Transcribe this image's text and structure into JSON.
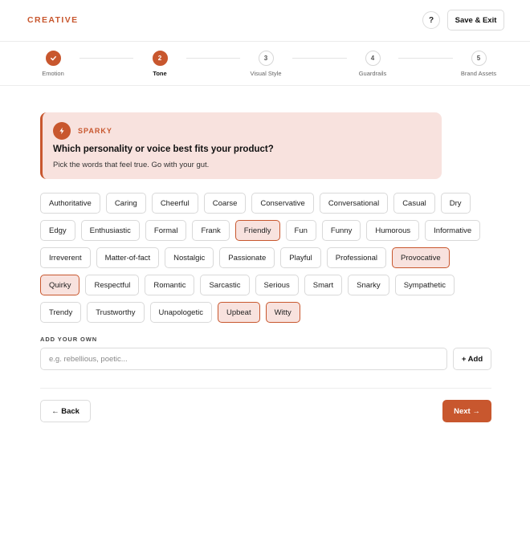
{
  "header": {
    "brand": "CREATIVE",
    "help_label": "?",
    "save_exit_label": "Save & Exit"
  },
  "stepper": {
    "steps": [
      {
        "label": "Emotion",
        "number": "1",
        "state": "done"
      },
      {
        "label": "Tone",
        "number": "2",
        "state": "active"
      },
      {
        "label": "Visual Style",
        "number": "3",
        "state": "pending"
      },
      {
        "label": "Guardrails",
        "number": "4",
        "state": "pending"
      },
      {
        "label": "Brand Assets",
        "number": "5",
        "state": "pending"
      }
    ],
    "done_icon": "checkmark-icon"
  },
  "card": {
    "icon": "lightning-icon",
    "tag": "SPARKY",
    "title": "Which personality or voice best fits your product?",
    "subtitle": "Pick the words that feel true. Go with your gut."
  },
  "chips": [
    {
      "label": "Authoritative",
      "selected": false
    },
    {
      "label": "Caring",
      "selected": false
    },
    {
      "label": "Cheerful",
      "selected": false
    },
    {
      "label": "Coarse",
      "selected": false
    },
    {
      "label": "Conservative",
      "selected": false
    },
    {
      "label": "Conversational",
      "selected": false
    },
    {
      "label": "Casual",
      "selected": false
    },
    {
      "label": "Dry",
      "selected": false
    },
    {
      "label": "Edgy",
      "selected": false
    },
    {
      "label": "Enthusiastic",
      "selected": false
    },
    {
      "label": "Formal",
      "selected": false
    },
    {
      "label": "Frank",
      "selected": false
    },
    {
      "label": "Friendly",
      "selected": true
    },
    {
      "label": "Fun",
      "selected": false
    },
    {
      "label": "Funny",
      "selected": false
    },
    {
      "label": "Humorous",
      "selected": false
    },
    {
      "label": "Informative",
      "selected": false
    },
    {
      "label": "Irreverent",
      "selected": false
    },
    {
      "label": "Matter-of-fact",
      "selected": false
    },
    {
      "label": "Nostalgic",
      "selected": false
    },
    {
      "label": "Passionate",
      "selected": false
    },
    {
      "label": "Playful",
      "selected": false
    },
    {
      "label": "Professional",
      "selected": false
    },
    {
      "label": "Provocative",
      "selected": true
    },
    {
      "label": "Quirky",
      "selected": true
    },
    {
      "label": "Respectful",
      "selected": false
    },
    {
      "label": "Romantic",
      "selected": false
    },
    {
      "label": "Sarcastic",
      "selected": false
    },
    {
      "label": "Serious",
      "selected": false
    },
    {
      "label": "Smart",
      "selected": false
    },
    {
      "label": "Snarky",
      "selected": false
    },
    {
      "label": "Sympathetic",
      "selected": false
    },
    {
      "label": "Trendy",
      "selected": false
    },
    {
      "label": "Trustworthy",
      "selected": false
    },
    {
      "label": "Unapologetic",
      "selected": false
    },
    {
      "label": "Upbeat",
      "selected": true
    },
    {
      "label": "Witty",
      "selected": true
    }
  ],
  "add_own": {
    "label": "ADD YOUR OWN",
    "placeholder": "e.g. rebellious, poetic...",
    "value": "",
    "button_label": "+ Add"
  },
  "nav": {
    "back_label": "← Back",
    "next_label": "Next →"
  },
  "colors": {
    "accent": "#c8572e",
    "selected_bg": "#f8e2de"
  }
}
